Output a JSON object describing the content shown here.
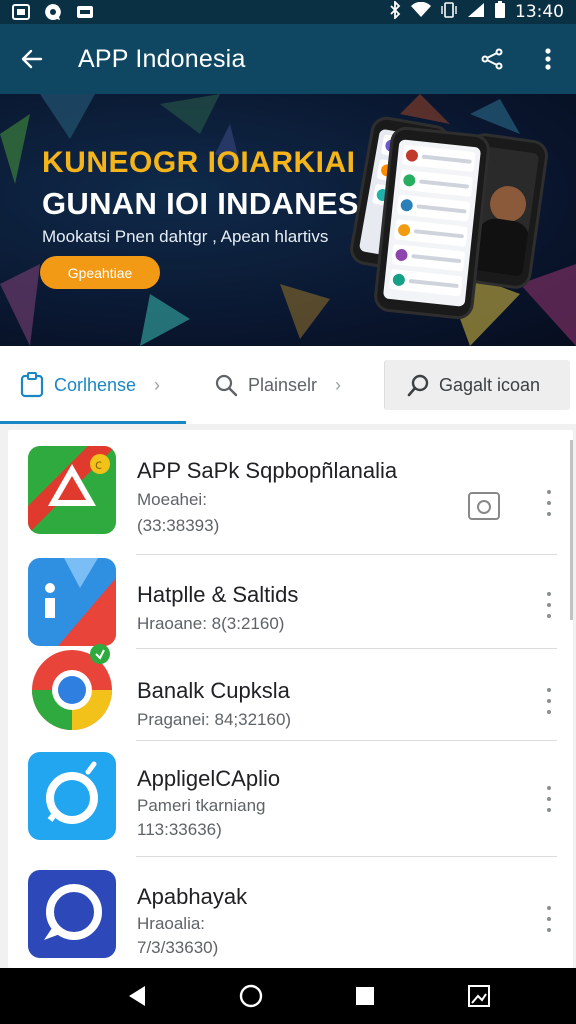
{
  "status_bar": {
    "time": "13:40",
    "icons": [
      "image-icon",
      "chat-icon",
      "message-icon",
      "bluetooth-icon",
      "wifi-icon",
      "vibrate-icon",
      "signal-icon",
      "battery-icon"
    ]
  },
  "app_bar": {
    "title": "APP Indonesia",
    "icons": [
      "back-arrow-icon",
      "share-icon",
      "more-vert-icon"
    ]
  },
  "banner": {
    "line1": "KUNEOGR IOIARKIAI",
    "line2": "GUNAN IOI  INDANESH",
    "line3": "Mookatsi Pnen dahtgr , Apean hlartivs",
    "cta": "Gpeahtiae",
    "accent_color": "#f4b41a",
    "cta_color": "#f29a16"
  },
  "tabs": {
    "items": [
      {
        "label": "Corlhense",
        "icon": "clipboard-icon",
        "active": true
      },
      {
        "label": "Plainselr",
        "icon": "search-icon",
        "active": false
      }
    ],
    "search": {
      "label": "Gagalt icoan",
      "icon": "search-icon"
    },
    "active_color": "#1b86c4"
  },
  "list": {
    "items": [
      {
        "name": "APP SaPk Sqpbopñlanalia",
        "line1": "Moeahei:",
        "line2": "(33:38393)",
        "icon": "red-triangle-app-icon",
        "extra_icon": "camera-icon"
      },
      {
        "name": "Hatplle & Saltids",
        "line1": "Hraoane: 8(3:2160)",
        "line2": "",
        "icon": "info-app-icon"
      },
      {
        "name": "Banalk Cupksla",
        "line1": "Praganei: 84;32160)",
        "line2": "",
        "icon": "chrome-app-icon"
      },
      {
        "name": "AppligelCAplio",
        "line1": "Pameri tkarniang",
        "line2": "113:33636)",
        "icon": "blue-ring-app-icon"
      },
      {
        "name": "Apabhayak",
        "line1": "Hraoalia:",
        "line2": "7/3/33630)",
        "icon": "chat-bubble-app-icon"
      }
    ]
  },
  "navbar": {
    "icons": [
      "back-triangle-icon",
      "home-circle-icon",
      "recents-square-icon",
      "screenshot-icon"
    ]
  }
}
